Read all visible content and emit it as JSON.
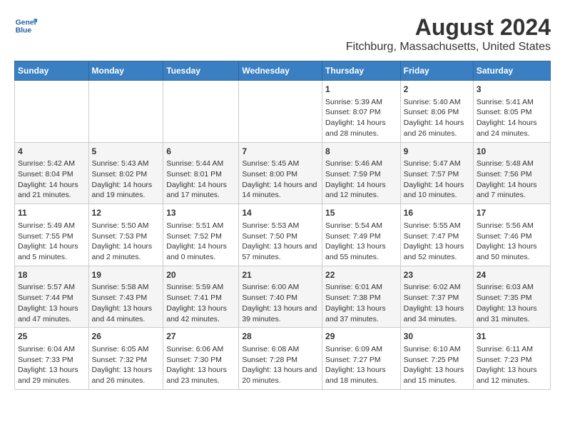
{
  "header": {
    "logo_line1": "General",
    "logo_line2": "Blue",
    "month_year": "August 2024",
    "location": "Fitchburg, Massachusetts, United States"
  },
  "days_of_week": [
    "Sunday",
    "Monday",
    "Tuesday",
    "Wednesday",
    "Thursday",
    "Friday",
    "Saturday"
  ],
  "weeks": [
    [
      {
        "day": "",
        "sunrise": "",
        "sunset": "",
        "daylight": ""
      },
      {
        "day": "",
        "sunrise": "",
        "sunset": "",
        "daylight": ""
      },
      {
        "day": "",
        "sunrise": "",
        "sunset": "",
        "daylight": ""
      },
      {
        "day": "",
        "sunrise": "",
        "sunset": "",
        "daylight": ""
      },
      {
        "day": "1",
        "sunrise": "Sunrise: 5:39 AM",
        "sunset": "Sunset: 8:07 PM",
        "daylight": "Daylight: 14 hours and 28 minutes."
      },
      {
        "day": "2",
        "sunrise": "Sunrise: 5:40 AM",
        "sunset": "Sunset: 8:06 PM",
        "daylight": "Daylight: 14 hours and 26 minutes."
      },
      {
        "day": "3",
        "sunrise": "Sunrise: 5:41 AM",
        "sunset": "Sunset: 8:05 PM",
        "daylight": "Daylight: 14 hours and 24 minutes."
      }
    ],
    [
      {
        "day": "4",
        "sunrise": "Sunrise: 5:42 AM",
        "sunset": "Sunset: 8:04 PM",
        "daylight": "Daylight: 14 hours and 21 minutes."
      },
      {
        "day": "5",
        "sunrise": "Sunrise: 5:43 AM",
        "sunset": "Sunset: 8:02 PM",
        "daylight": "Daylight: 14 hours and 19 minutes."
      },
      {
        "day": "6",
        "sunrise": "Sunrise: 5:44 AM",
        "sunset": "Sunset: 8:01 PM",
        "daylight": "Daylight: 14 hours and 17 minutes."
      },
      {
        "day": "7",
        "sunrise": "Sunrise: 5:45 AM",
        "sunset": "Sunset: 8:00 PM",
        "daylight": "Daylight: 14 hours and 14 minutes."
      },
      {
        "day": "8",
        "sunrise": "Sunrise: 5:46 AM",
        "sunset": "Sunset: 7:59 PM",
        "daylight": "Daylight: 14 hours and 12 minutes."
      },
      {
        "day": "9",
        "sunrise": "Sunrise: 5:47 AM",
        "sunset": "Sunset: 7:57 PM",
        "daylight": "Daylight: 14 hours and 10 minutes."
      },
      {
        "day": "10",
        "sunrise": "Sunrise: 5:48 AM",
        "sunset": "Sunset: 7:56 PM",
        "daylight": "Daylight: 14 hours and 7 minutes."
      }
    ],
    [
      {
        "day": "11",
        "sunrise": "Sunrise: 5:49 AM",
        "sunset": "Sunset: 7:55 PM",
        "daylight": "Daylight: 14 hours and 5 minutes."
      },
      {
        "day": "12",
        "sunrise": "Sunrise: 5:50 AM",
        "sunset": "Sunset: 7:53 PM",
        "daylight": "Daylight: 14 hours and 2 minutes."
      },
      {
        "day": "13",
        "sunrise": "Sunrise: 5:51 AM",
        "sunset": "Sunset: 7:52 PM",
        "daylight": "Daylight: 14 hours and 0 minutes."
      },
      {
        "day": "14",
        "sunrise": "Sunrise: 5:53 AM",
        "sunset": "Sunset: 7:50 PM",
        "daylight": "Daylight: 13 hours and 57 minutes."
      },
      {
        "day": "15",
        "sunrise": "Sunrise: 5:54 AM",
        "sunset": "Sunset: 7:49 PM",
        "daylight": "Daylight: 13 hours and 55 minutes."
      },
      {
        "day": "16",
        "sunrise": "Sunrise: 5:55 AM",
        "sunset": "Sunset: 7:47 PM",
        "daylight": "Daylight: 13 hours and 52 minutes."
      },
      {
        "day": "17",
        "sunrise": "Sunrise: 5:56 AM",
        "sunset": "Sunset: 7:46 PM",
        "daylight": "Daylight: 13 hours and 50 minutes."
      }
    ],
    [
      {
        "day": "18",
        "sunrise": "Sunrise: 5:57 AM",
        "sunset": "Sunset: 7:44 PM",
        "daylight": "Daylight: 13 hours and 47 minutes."
      },
      {
        "day": "19",
        "sunrise": "Sunrise: 5:58 AM",
        "sunset": "Sunset: 7:43 PM",
        "daylight": "Daylight: 13 hours and 44 minutes."
      },
      {
        "day": "20",
        "sunrise": "Sunrise: 5:59 AM",
        "sunset": "Sunset: 7:41 PM",
        "daylight": "Daylight: 13 hours and 42 minutes."
      },
      {
        "day": "21",
        "sunrise": "Sunrise: 6:00 AM",
        "sunset": "Sunset: 7:40 PM",
        "daylight": "Daylight: 13 hours and 39 minutes."
      },
      {
        "day": "22",
        "sunrise": "Sunrise: 6:01 AM",
        "sunset": "Sunset: 7:38 PM",
        "daylight": "Daylight: 13 hours and 37 minutes."
      },
      {
        "day": "23",
        "sunrise": "Sunrise: 6:02 AM",
        "sunset": "Sunset: 7:37 PM",
        "daylight": "Daylight: 13 hours and 34 minutes."
      },
      {
        "day": "24",
        "sunrise": "Sunrise: 6:03 AM",
        "sunset": "Sunset: 7:35 PM",
        "daylight": "Daylight: 13 hours and 31 minutes."
      }
    ],
    [
      {
        "day": "25",
        "sunrise": "Sunrise: 6:04 AM",
        "sunset": "Sunset: 7:33 PM",
        "daylight": "Daylight: 13 hours and 29 minutes."
      },
      {
        "day": "26",
        "sunrise": "Sunrise: 6:05 AM",
        "sunset": "Sunset: 7:32 PM",
        "daylight": "Daylight: 13 hours and 26 minutes."
      },
      {
        "day": "27",
        "sunrise": "Sunrise: 6:06 AM",
        "sunset": "Sunset: 7:30 PM",
        "daylight": "Daylight: 13 hours and 23 minutes."
      },
      {
        "day": "28",
        "sunrise": "Sunrise: 6:08 AM",
        "sunset": "Sunset: 7:28 PM",
        "daylight": "Daylight: 13 hours and 20 minutes."
      },
      {
        "day": "29",
        "sunrise": "Sunrise: 6:09 AM",
        "sunset": "Sunset: 7:27 PM",
        "daylight": "Daylight: 13 hours and 18 minutes."
      },
      {
        "day": "30",
        "sunrise": "Sunrise: 6:10 AM",
        "sunset": "Sunset: 7:25 PM",
        "daylight": "Daylight: 13 hours and 15 minutes."
      },
      {
        "day": "31",
        "sunrise": "Sunrise: 6:11 AM",
        "sunset": "Sunset: 7:23 PM",
        "daylight": "Daylight: 13 hours and 12 minutes."
      }
    ]
  ]
}
